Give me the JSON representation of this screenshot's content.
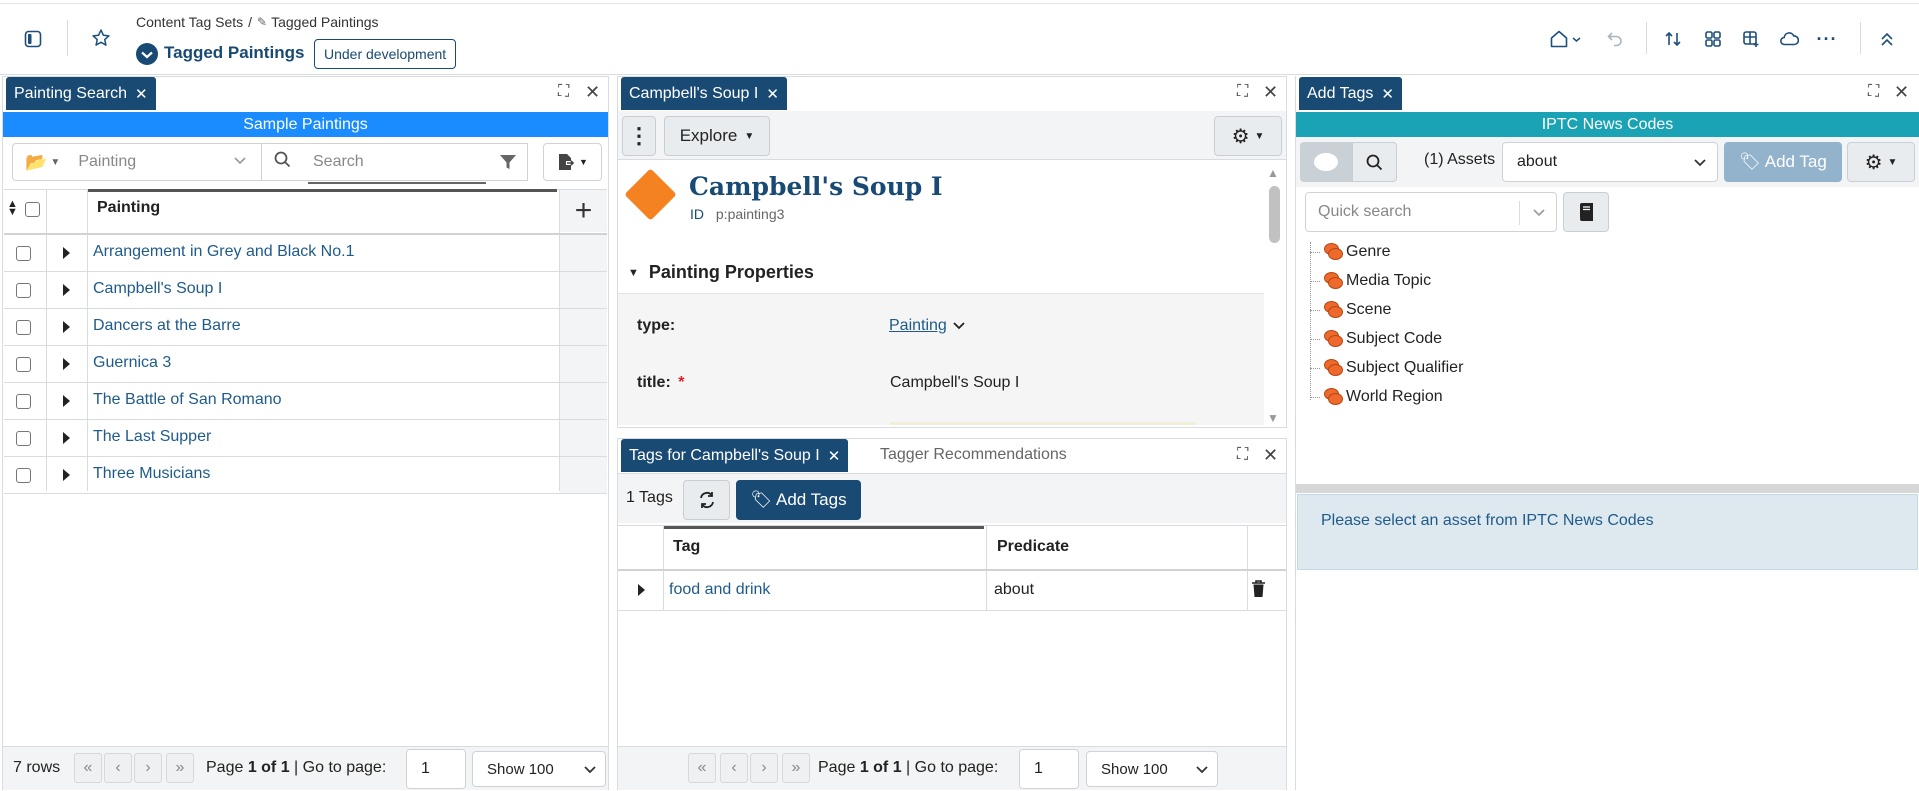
{
  "header": {
    "breadcrumb_root": "Content Tag Sets",
    "breadcrumb_sep": "/",
    "breadcrumb_current": "Tagged Paintings",
    "title": "Tagged Paintings",
    "status_badge": "Under development"
  },
  "left_panel": {
    "tab_label": "Painting Search",
    "banner": "Sample Paintings",
    "type_select": "Painting",
    "search_placeholder": "Search",
    "column_header": "Painting",
    "rows": [
      "Arrangement in Grey and Black No.1",
      "Campbell's Soup I",
      "Dancers at the Barre",
      "Guernica 3",
      "The Battle of San Romano",
      "The Last Supper",
      "Three Musicians"
    ],
    "footer": {
      "row_count": "7 rows",
      "page_prefix": "Page ",
      "page_value": "1 of 1",
      "goto_label": " | Go to page:",
      "goto_value": "1",
      "show_select": "Show 100"
    }
  },
  "middle_panel": {
    "tab_label": "Campbell's Soup I",
    "explore_label": "Explore",
    "asset_title": "Campbell's Soup I",
    "id_label": "ID",
    "id_value": "p:painting3",
    "section_title": "Painting Properties",
    "properties": {
      "type_label": "type:",
      "type_value": "Painting",
      "title_label": "title:",
      "required_mark": "*",
      "title_value": "Campbell's Soup I"
    }
  },
  "tags_panel": {
    "tab_active": "Tags for Campbell's Soup I",
    "tab_inactive": "Tagger Recommendations",
    "count_label": "1 Tags",
    "add_tags_label": "Add Tags",
    "columns": [
      "Tag",
      "Predicate"
    ],
    "rows": [
      {
        "tag": "food and drink",
        "predicate": "about"
      }
    ],
    "footer": {
      "page_prefix": "Page ",
      "page_value": "1 of 1",
      "goto_label": " | Go to page:",
      "goto_value": "1",
      "show_select": "Show 100"
    }
  },
  "right_panel": {
    "tab_label": "Add Tags",
    "banner": "IPTC News Codes",
    "assets_label": "(1) Assets",
    "predicate_select": "about",
    "add_tag_label": "Add Tag",
    "quick_search_placeholder": "Quick search",
    "tree": [
      "Genre",
      "Media Topic",
      "Scene",
      "Subject Code",
      "Subject Qualifier",
      "World Region"
    ],
    "info_message": "Please select an asset from IPTC News Codes"
  },
  "colors": {
    "primary": "#194a73",
    "blue_banner": "#1a8cff",
    "teal_banner": "#1aa3b5",
    "link": "#1f5b8a",
    "orange": "#f58220",
    "info_bg": "#dde8ef"
  }
}
